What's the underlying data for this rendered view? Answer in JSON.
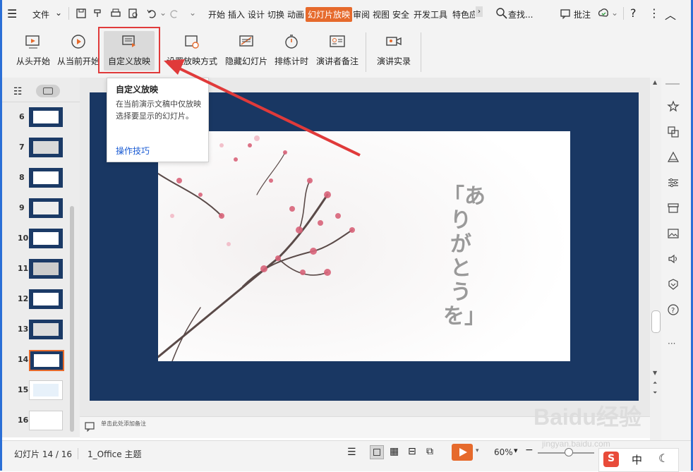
{
  "menubar": {
    "file_label": "文件",
    "tabs": [
      "开始",
      "插入",
      "设计",
      "切换",
      "动画",
      "幻灯片放映",
      "审阅",
      "视图",
      "安全",
      "开发工具",
      "特色应"
    ],
    "active_tab": "幻灯片放映",
    "search_label": "查找...",
    "comment_label": "批注",
    "help_label": "?"
  },
  "ribbon": {
    "buttons": [
      {
        "label": "从头开始"
      },
      {
        "label": "从当前开始"
      },
      {
        "label": "自定义放映"
      },
      {
        "label": "设置放映方式"
      },
      {
        "label": "隐藏幻灯片"
      },
      {
        "label": "排练计时"
      },
      {
        "label": "演讲者备注"
      },
      {
        "label": "演讲实录"
      }
    ]
  },
  "tooltip": {
    "title": "自定义放映",
    "description": "在当前演示文稿中仅放映选择要显示的幻灯片。",
    "link": "操作技巧"
  },
  "slides_panel": {
    "numbers": [
      "6",
      "7",
      "8",
      "9",
      "10",
      "11",
      "12",
      "13",
      "14",
      "15",
      "16"
    ],
    "current": "14"
  },
  "slide": {
    "text": "「ありがとうを」",
    "background_color": "#193763"
  },
  "notes": {
    "placeholder": "单击此处添加备注"
  },
  "status": {
    "slide_info": "幻灯片 14 / 16",
    "theme": "1_Office 主题",
    "zoom": "60%"
  },
  "ime": {
    "lang": "中"
  },
  "watermark": {
    "brand": "Baidu经验",
    "url": "jingyan.baidu.com"
  },
  "colors": {
    "accent": "#e66a2c",
    "highlight_red": "#e03a3a",
    "link_blue": "#1a5bd3"
  }
}
